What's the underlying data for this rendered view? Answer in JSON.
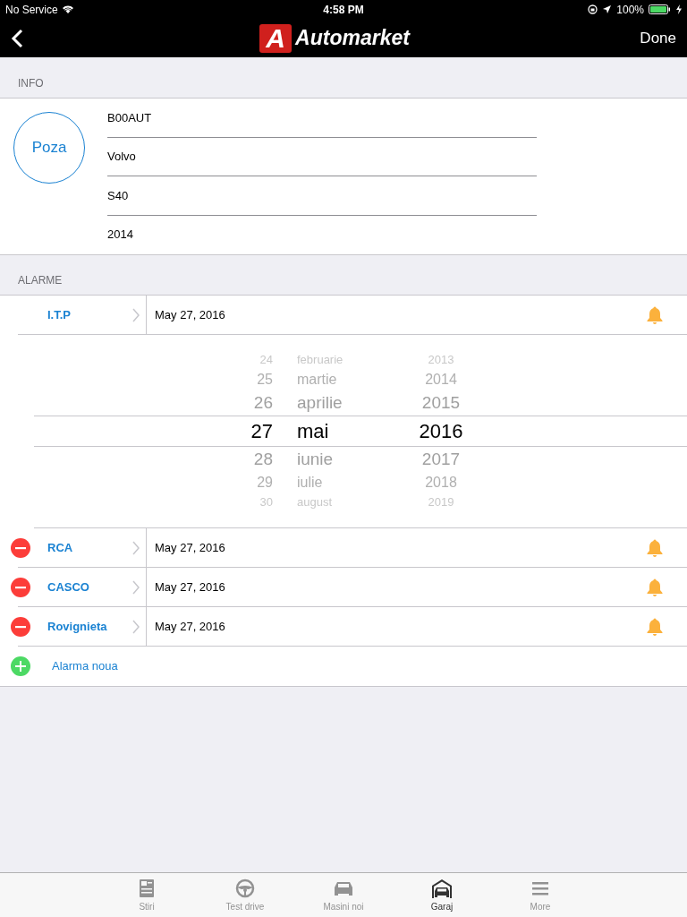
{
  "status_bar": {
    "carrier": "No Service",
    "time": "4:58 PM",
    "battery": "100%"
  },
  "nav": {
    "logo_letter": "A",
    "logo_text": "Automarket",
    "done": "Done"
  },
  "info": {
    "header": "INFO",
    "photo": "Poza",
    "fields": [
      "B00AUT",
      "Volvo",
      "S40",
      "2014"
    ]
  },
  "alarms": {
    "header": "ALARME",
    "items": [
      {
        "label": "I.T.P",
        "date": "May 27, 2016",
        "deletable": false,
        "expanded": true,
        "picker": [
          {
            "day": "24",
            "month": "februarie",
            "year": "2013",
            "selected": false
          },
          {
            "day": "25",
            "month": "martie",
            "year": "2014",
            "selected": false
          },
          {
            "day": "26",
            "month": "aprilie",
            "year": "2015",
            "selected": false
          },
          {
            "day": "27",
            "month": "mai",
            "year": "2016",
            "selected": true
          },
          {
            "day": "28",
            "month": "iunie",
            "year": "2017",
            "selected": false
          },
          {
            "day": "29",
            "month": "iulie",
            "year": "2018",
            "selected": false
          },
          {
            "day": "30",
            "month": "august",
            "year": "2019",
            "selected": false
          }
        ]
      },
      {
        "label": "RCA",
        "date": "May 27, 2016",
        "deletable": true,
        "expanded": false
      },
      {
        "label": "CASCO",
        "date": "May 27, 2016",
        "deletable": true,
        "expanded": false
      },
      {
        "label": "Rovignieta",
        "date": "May 27, 2016",
        "deletable": true,
        "expanded": false
      }
    ],
    "add": "Alarma noua"
  },
  "tabs": [
    {
      "label": "Stiri",
      "kind": "news",
      "selected": false
    },
    {
      "label": "Test drive",
      "kind": "wheel",
      "selected": false
    },
    {
      "label": "Masini noi",
      "kind": "car",
      "selected": false
    },
    {
      "label": "Garaj",
      "kind": "garage",
      "selected": true
    },
    {
      "label": "More",
      "kind": "menu",
      "selected": false
    }
  ]
}
